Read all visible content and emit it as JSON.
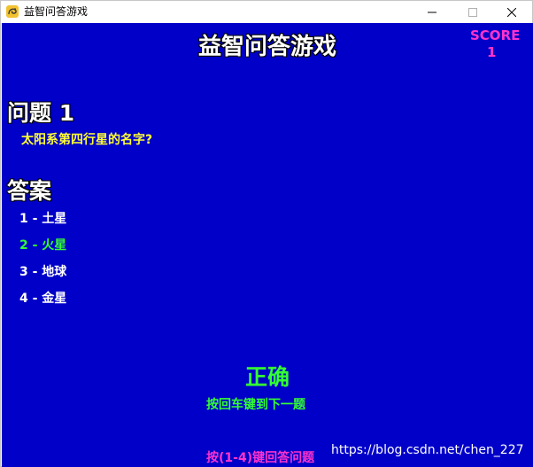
{
  "window": {
    "title": "益智问答游戏",
    "icon": "pygame-snake-icon"
  },
  "controls": {
    "minimize": "minimize-icon",
    "maximize": "maximize-icon",
    "close": "close-icon"
  },
  "game": {
    "title": "益智问答游戏",
    "score_label": "SCORE",
    "score_value": "1",
    "question_heading": "问题 1",
    "question_text": "太阳系第四行星的名字?",
    "answers_heading": "答案",
    "answers": [
      {
        "label": "1 - 土星",
        "state": "normal"
      },
      {
        "label": "2 - 火星",
        "state": "correct"
      },
      {
        "label": "3 - 地球",
        "state": "normal"
      },
      {
        "label": "4 - 金星",
        "state": "normal"
      }
    ],
    "result": "正确",
    "next_hint": "按回车键到下一题",
    "answer_hint": "按(1-4)键回答问题"
  },
  "watermark": "https://blog.csdn.net/chen_227",
  "colors": {
    "background": "#0000c8",
    "heading": "#ffffff",
    "question": "#ffff33",
    "correct": "#33ff33",
    "score": "#ff33cc"
  }
}
